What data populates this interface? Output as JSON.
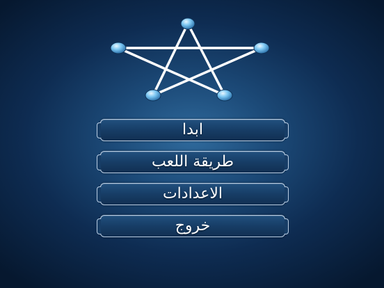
{
  "menu": {
    "start": "ابدا",
    "how_to_play": "طريقة اللعب",
    "settings": "الاعدادات",
    "exit": "خروج"
  },
  "logo": {
    "icon": "star-of-connected-dots-icon",
    "line_color": "#ffffff",
    "node_color": "#6fc0f2"
  },
  "colors": {
    "background": "#1c4a78",
    "button_border": "#b9cde3",
    "button_fill": "#173d66",
    "text": "#ffffff"
  }
}
